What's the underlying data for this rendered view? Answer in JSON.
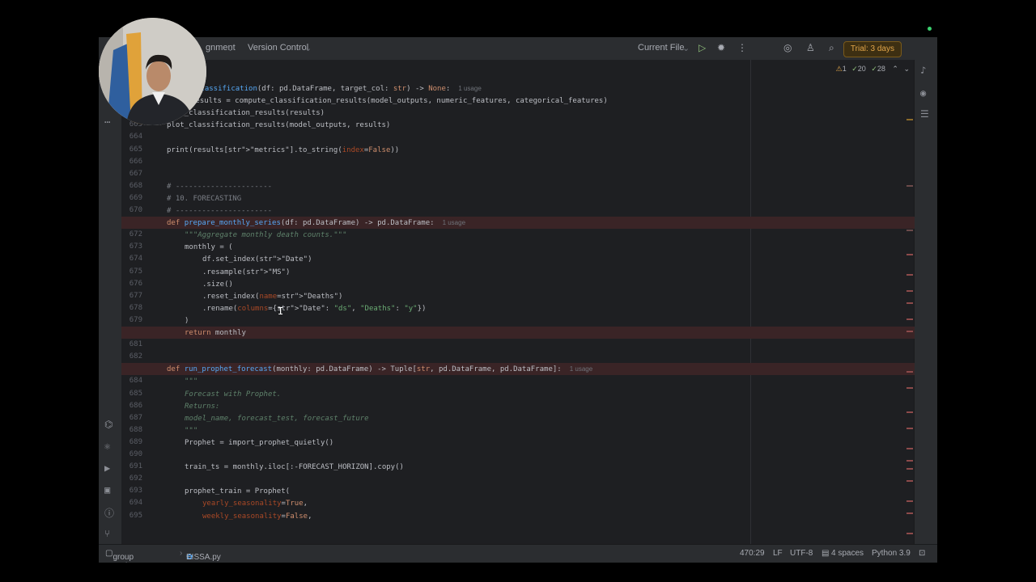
{
  "titlebar": {
    "project_fragment": "gnment",
    "vcs": "Version Control",
    "run_config": "Current File",
    "trial": "Trial: 3 days"
  },
  "inspections": {
    "warnings": "1",
    "weak": "20",
    "typos": "28"
  },
  "icons": {
    "run": "run-icon",
    "debug": "debug-icon",
    "more": "more-icon",
    "copilot": "ai-icon",
    "user": "user-icon",
    "search": "search-icon",
    "settings": "gear-icon",
    "bell": "notification-icon",
    "db": "database-icon"
  },
  "lines": [
    {
      "num": "",
      "text": "classification(df: pd.DataFrame, target_col: str) -> None:",
      "hint": "1 usage"
    },
    {
      "num": "",
      "text": "results = compute_classification_results(model_outputs, numeric_features, categorical_features)"
    },
    {
      "num": "662",
      "text": "save_classification_results(results)"
    },
    {
      "num": "663",
      "text": "plot_classification_results(model_outputs, results)"
    },
    {
      "num": "664",
      "text": ""
    },
    {
      "num": "665",
      "text": "print(results[\"metrics\"].to_string(index=False))"
    },
    {
      "num": "666",
      "text": ""
    },
    {
      "num": "667",
      "text": ""
    },
    {
      "num": "668",
      "text": "# ----------------------"
    },
    {
      "num": "669",
      "text": "# 10. FORECASTING"
    },
    {
      "num": "670",
      "text": "# ----------------------"
    },
    {
      "num": "671",
      "text": "def prepare_monthly_series(df: pd.DataFrame) -> pd.DataFrame:",
      "hint": "1 usage"
    },
    {
      "num": "672",
      "text": "\"\"\"Aggregate monthly death counts.\"\"\""
    },
    {
      "num": "673",
      "text": "monthly = ("
    },
    {
      "num": "674",
      "text": "df.set_index(\"Date\")"
    },
    {
      "num": "675",
      "text": ".resample(\"MS\")"
    },
    {
      "num": "676",
      "text": ".size()"
    },
    {
      "num": "677",
      "text": ".reset_index(name=\"Deaths\")"
    },
    {
      "num": "678",
      "text": ".rename(columns={\"Date\": \"ds\", \"Deaths\": \"y\"})"
    },
    {
      "num": "679",
      "text": ")"
    },
    {
      "num": "680",
      "text": "return monthly"
    },
    {
      "num": "681",
      "text": ""
    },
    {
      "num": "682",
      "text": ""
    },
    {
      "num": "683",
      "text": "def run_prophet_forecast(monthly: pd.DataFrame) -> Tuple[str, pd.DataFrame, pd.DataFrame]:",
      "hint": "1 usage"
    },
    {
      "num": "684",
      "text": "\"\"\""
    },
    {
      "num": "685",
      "text": "Forecast with Prophet."
    },
    {
      "num": "686",
      "text": "Returns:"
    },
    {
      "num": "687",
      "text": "model_name, forecast_test, forecast_future"
    },
    {
      "num": "688",
      "text": "\"\"\""
    },
    {
      "num": "689",
      "text": "Prophet = import_prophet_quietly()"
    },
    {
      "num": "690",
      "text": ""
    },
    {
      "num": "691",
      "text": "train_ts = monthly.iloc[:-FORECAST_HORIZON].copy()"
    },
    {
      "num": "692",
      "text": ""
    },
    {
      "num": "693",
      "text": "prophet_train = Prophet("
    },
    {
      "num": "694",
      "text": "yearly_seasonality=True,"
    },
    {
      "num": "695",
      "text": "weekly_seasonality=False,"
    }
  ],
  "statusbar": {
    "project": "group assigment",
    "file": "EISSA.py",
    "position": "470:29",
    "line_sep": "LF",
    "encoding": "UTF-8",
    "indent": "4 spaces",
    "interpreter": "Python 3.9"
  }
}
